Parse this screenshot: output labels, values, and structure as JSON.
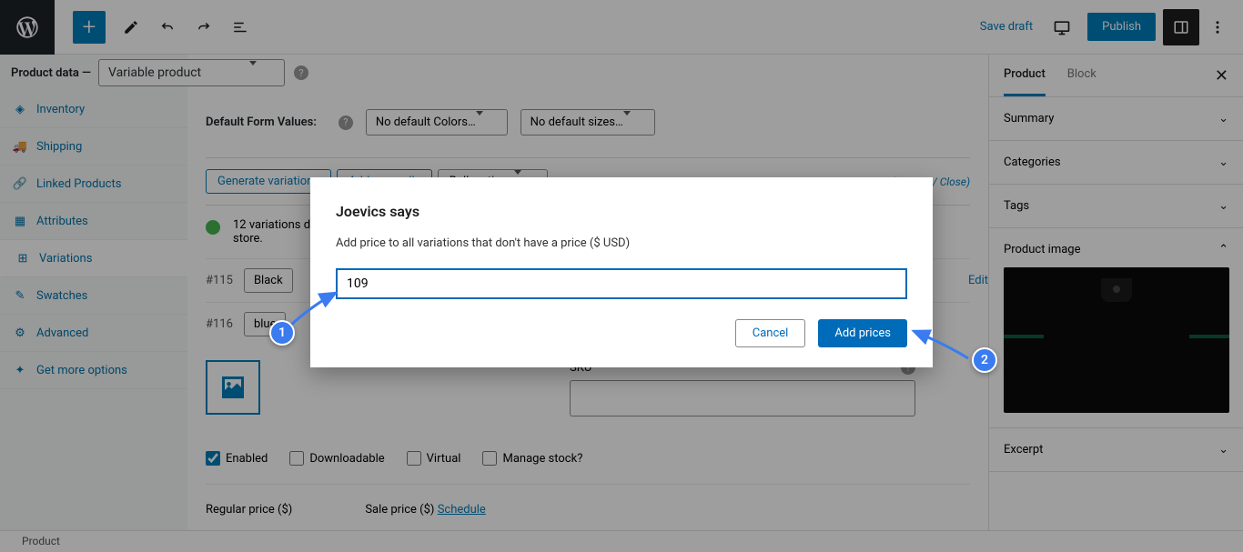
{
  "toolbar": {
    "save_draft": "Save draft",
    "publish": "Publish"
  },
  "product_data": {
    "label": "Product data —",
    "type": "Variable product"
  },
  "tabs": {
    "inventory": "Inventory",
    "shipping": "Shipping",
    "linked": "Linked Products",
    "attributes": "Attributes",
    "variations": "Variations",
    "swatches": "Swatches",
    "advanced": "Advanced",
    "get_more": "Get more options"
  },
  "defaults": {
    "label": "Default Form Values:",
    "colors": "No default Colors…",
    "sizes": "No default sizes…"
  },
  "actions": {
    "generate": "Generate variations",
    "add_manually": "Add manually",
    "bulk": "Bulk actions",
    "count_text": "12 variations",
    "expand_close": "(Expand / Close)"
  },
  "notice": {
    "text_prefix": "12 variations d",
    "text_suffix": "store."
  },
  "variations": [
    {
      "id": "#115",
      "color": "Black",
      "edit": "Edit"
    },
    {
      "id": "#116",
      "color": "blue"
    }
  ],
  "detail": {
    "sku_label": "SKU",
    "enabled": "Enabled",
    "downloadable": "Downloadable",
    "virtual": "Virtual",
    "manage_stock": "Manage stock?",
    "regular_price": "Regular price ($)",
    "sale_price": "Sale price ($)",
    "schedule": "Schedule"
  },
  "right_panel": {
    "tab_product": "Product",
    "tab_block": "Block",
    "summary": "Summary",
    "categories": "Categories",
    "tags": "Tags",
    "product_image": "Product image",
    "excerpt": "Excerpt"
  },
  "breadcrumb": "Product",
  "dialog": {
    "title": "Joevics says",
    "message": "Add price to all variations that don't have a price ($ USD)",
    "value": "109",
    "cancel": "Cancel",
    "confirm": "Add prices"
  },
  "annotations": {
    "b1": "1",
    "b2": "2"
  }
}
